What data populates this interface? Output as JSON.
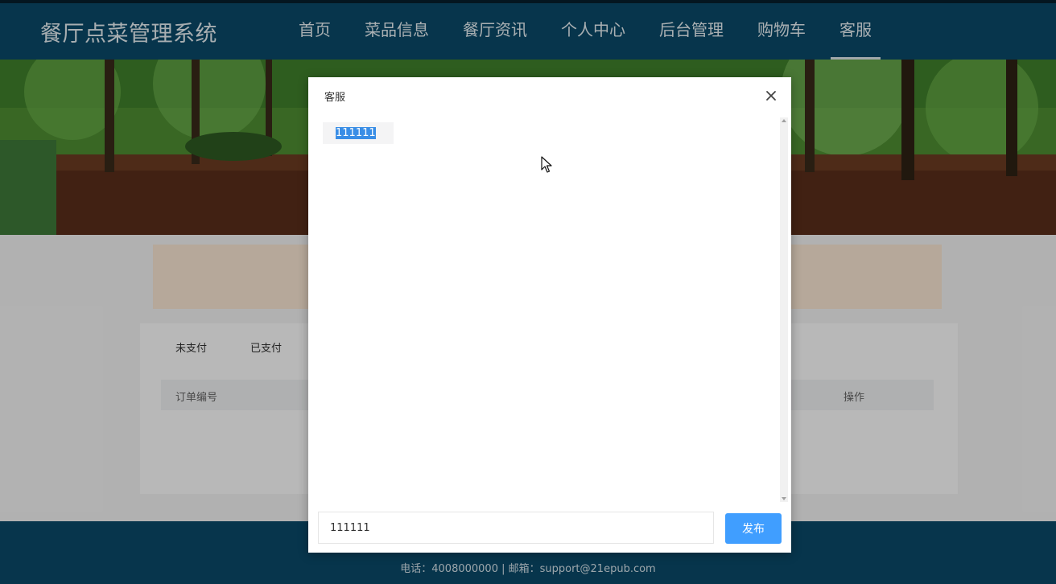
{
  "header": {
    "brand": "餐厅点菜管理系统",
    "nav": [
      {
        "label": "首页",
        "active": false
      },
      {
        "label": "菜品信息",
        "active": false
      },
      {
        "label": "餐厅资讯",
        "active": false
      },
      {
        "label": "个人中心",
        "active": false
      },
      {
        "label": "后台管理",
        "active": false
      },
      {
        "label": "购物车",
        "active": false
      },
      {
        "label": "客服",
        "active": true
      }
    ]
  },
  "orders": {
    "tabs": [
      "未支付",
      "已支付"
    ],
    "columns": {
      "order_no": "订单编号",
      "actions": "操作"
    }
  },
  "footer": {
    "contact": "电话：4008000000 | 邮箱：support@21epub.com"
  },
  "dialog": {
    "title": "客服",
    "messages": [
      {
        "text": "111111",
        "selected": true
      }
    ],
    "input_value": "111111",
    "send_label": "发布"
  },
  "colors": {
    "header_bg": "#0b4a6a",
    "send_button": "#409eff",
    "selection": "#3a8ee6"
  }
}
